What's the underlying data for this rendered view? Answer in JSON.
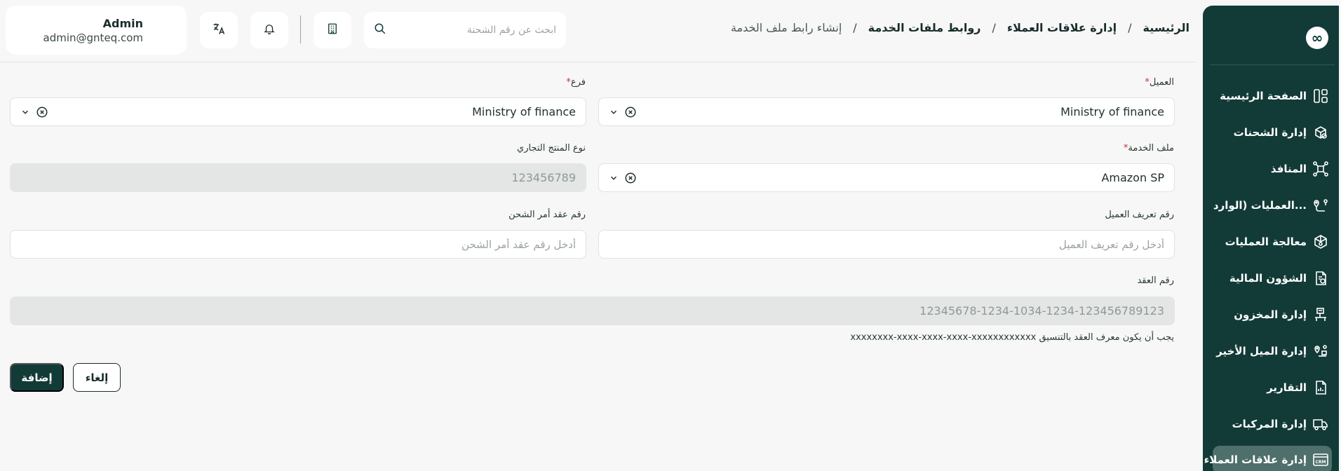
{
  "sidebar": {
    "logo": "∞",
    "items": [
      {
        "label": "الصفحة الرئيسية",
        "icon": "dashboard-icon"
      },
      {
        "label": "إدارة الشحنات",
        "icon": "package-icon"
      },
      {
        "label": "المنافذ",
        "icon": "network-icon"
      },
      {
        "label": "العمليات (الوارد...",
        "icon": "route-icon"
      },
      {
        "label": "معالجة العمليات",
        "icon": "box-process-icon"
      },
      {
        "label": "الشؤون المالية",
        "icon": "finance-doc-icon"
      },
      {
        "label": "إدارة المخزون",
        "icon": "warehouse-icon"
      },
      {
        "label": "إدارة الميل الأخير",
        "icon": "last-mile-icon"
      },
      {
        "label": "التقارير",
        "icon": "report-icon"
      },
      {
        "label": "إدارة المركبات",
        "icon": "truck-icon"
      },
      {
        "label": "إدارة علاقات العملاء",
        "icon": "crm-icon",
        "active": true
      }
    ]
  },
  "header": {
    "breadcrumb": [
      "الرئيسية",
      "إدارة علاقات العملاء",
      "روابط ملفات الخدمة",
      "إنشاء رابط ملف الخدمة"
    ],
    "separator": "/",
    "search_placeholder": "ابحث عن رقم الشحنة",
    "user": {
      "name": "Admin",
      "email": "admin@gnteq.com"
    }
  },
  "form": {
    "customer": {
      "label": "العميل",
      "required": "*",
      "value": "Ministry of finance"
    },
    "branch": {
      "label": "فرع",
      "required": "*",
      "value": "Ministry of finance"
    },
    "service_profile": {
      "label": "ملف الخدمة",
      "required": "*",
      "value": "Amazon SP"
    },
    "product_type": {
      "label": "نوع المنتج التجاري",
      "value": "123456789"
    },
    "customer_id": {
      "label": "رقم تعريف العميل",
      "placeholder": "أدخل رقم تعريف العميل"
    },
    "shipping_order": {
      "label": "رقم عقد أمر الشحن",
      "placeholder": "أدخل رقم عقد أمر الشحن"
    },
    "contract_number": {
      "label": "رقم العقد",
      "value": "12345678-1234-1034-1234-123456789123"
    },
    "hint": "يجب أن يكون معرف العقد بالتنسيق xxxxxxxx-xxxx-xxxx-xxxx-xxxxxxxxxxxx"
  },
  "actions": {
    "add": "إضافة",
    "cancel": "إلغاء"
  },
  "colors": {
    "primary": "#123b38",
    "required": "#d32f2f",
    "background": "#f6f7f6"
  }
}
